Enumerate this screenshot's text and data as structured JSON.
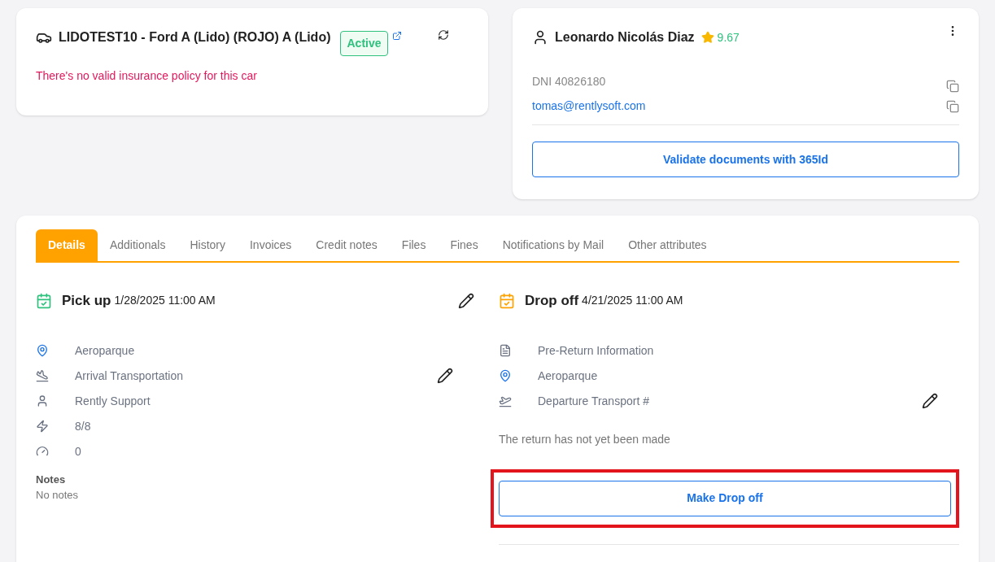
{
  "vehicle": {
    "title": "LIDOTEST10 - Ford A (Lido) (ROJO) A (Lido)",
    "status": "Active",
    "warning": "There's no valid insurance policy for this car"
  },
  "customer": {
    "name": "Leonardo Nicolás Diaz",
    "rating": "9.67",
    "document": "DNI 40826180",
    "email": "tomas@rentlysoft.com",
    "validate_button": "Validate documents with 365Id"
  },
  "tabs": [
    {
      "label": "Details",
      "selected": true
    },
    {
      "label": "Additionals",
      "selected": false
    },
    {
      "label": "History",
      "selected": false
    },
    {
      "label": "Invoices",
      "selected": false
    },
    {
      "label": "Credit notes",
      "selected": false
    },
    {
      "label": "Files",
      "selected": false
    },
    {
      "label": "Fines",
      "selected": false
    },
    {
      "label": "Notifications by Mail",
      "selected": false
    },
    {
      "label": "Other attributes",
      "selected": false
    }
  ],
  "pickup": {
    "title": "Pick up",
    "date": "1/28/2025 11:00 AM",
    "rows": [
      {
        "kind": "location",
        "text": "Aeroparque",
        "editable": false
      },
      {
        "kind": "arrival",
        "text": "Arrival Transportation",
        "editable": true
      },
      {
        "kind": "person",
        "text": "Rently Support",
        "editable": false
      },
      {
        "kind": "fuel",
        "text": "8/8",
        "editable": false
      },
      {
        "kind": "mileage",
        "text": "0",
        "editable": false
      }
    ],
    "notes_label": "Notes",
    "notes": "No notes"
  },
  "dropoff": {
    "title": "Drop off",
    "date": "4/21/2025 11:00 AM",
    "rows": [
      {
        "kind": "document",
        "text": "Pre-Return Information",
        "editable": false
      },
      {
        "kind": "location",
        "text": "Aeroparque",
        "editable": false
      },
      {
        "kind": "departure",
        "text": "Departure Transport #",
        "editable": true
      }
    ],
    "message": "The return has not yet been made",
    "button": "Make Drop off"
  }
}
